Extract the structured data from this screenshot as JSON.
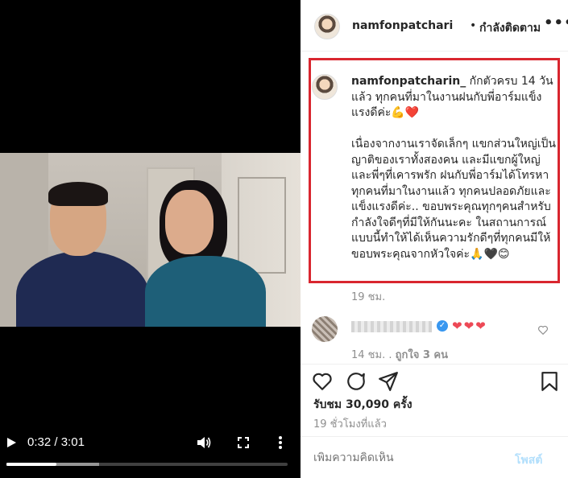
{
  "video": {
    "current_time": "0:32",
    "duration": "3:01",
    "time_separator": " / ",
    "progress": 0.177,
    "buffered": 0.33,
    "icons": {
      "play": "play-icon",
      "volume": "volume-icon",
      "fullscreen": "fullscreen-icon",
      "more": "more-vertical-icon"
    }
  },
  "header": {
    "username": "namfonpatchari",
    "dot": "•",
    "follow_status": "กำลังติดตาม",
    "more": "•••"
  },
  "caption": {
    "username": "namfonpatcharin_",
    "text": " กักตัวครบ 14 วันแล้ว ทุกคนที่มาในงานฝนกับพี่อาร์มแข็งแรงดีค่ะ💪❤️\n\nเนื่องจากงานเราจัดเล็กๆ แขกส่วนใหญ่เป็นญาติของเราทั้งสองคน และมีแขกผู้ใหญ่ และพี่ๆที่เคารพรัก ฝนกับพี่อาร์มได้โทรหาทุกคนที่มาในงานแล้ว ทุกคนปลอดภัยและแข็งแรงดีค่ะ.. ขอบพระคุณทุกๆคนสำหรับกำลังใจดีๆที่มีให้กันนะคะ ในสถานการณ์แบบนี้ทำให้ได้เห็นความรักดีๆที่ทุกคนมีให้ ขอบพระคุณจากหัวใจค่ะ🙏🖤😊",
    "time": "19 ชม.",
    "highlight_color": "#d9262f"
  },
  "comment": {
    "text": "❤❤❤",
    "time": "14 ชม.",
    "likes": "ถูกใจ 3 คน",
    "verified_icon": "verified-badge-icon"
  },
  "actions": {
    "icons": [
      "heart-icon",
      "comment-icon",
      "share-icon",
      "bookmark-icon"
    ]
  },
  "stats": {
    "views": "รับชม 30,090 ครั้ง",
    "posted": "19 ชั่วโมงที่แล้ว"
  },
  "input": {
    "placeholder": "เพิ่มความคิดเห็น",
    "post_label": "โพสต์"
  }
}
